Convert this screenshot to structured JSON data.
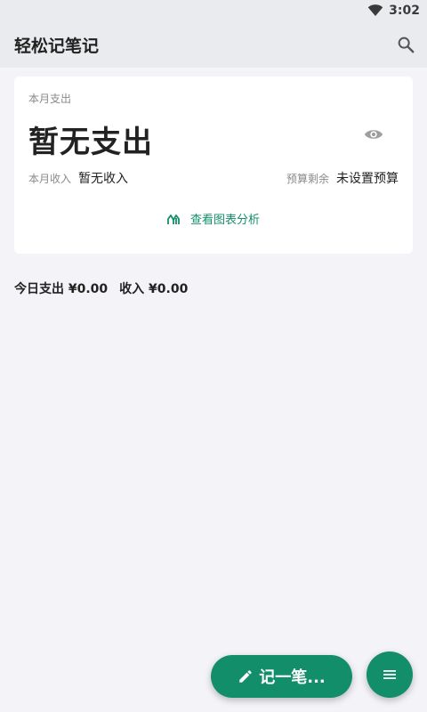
{
  "status_bar": {
    "time": "3:02",
    "icons": [
      "wifi-icon"
    ]
  },
  "app_bar": {
    "title": "轻松记笔记",
    "search_icon": "search-icon"
  },
  "summary_card": {
    "month_expense_label": "本月支出",
    "month_expense_value": "暂无支出",
    "visibility_icon": "eye-icon",
    "month_income_label": "本月收入",
    "month_income_value": "暂无收入",
    "budget_remaining_label": "预算剩余",
    "budget_remaining_value": "未设置预算",
    "chart_link_label": "查看图表分析",
    "chart_link_icon": "chart-icon"
  },
  "today": {
    "expense_text": "今日支出 ¥0.00",
    "income_text": "收入 ¥0.00"
  },
  "fab": {
    "record_label": "记一笔...",
    "record_icon": "pencil-icon",
    "menu_icon": "menu-icon"
  },
  "colors": {
    "accent": "#138e6a",
    "background": "#f4f4f8",
    "appbar": "#e9ebee",
    "card": "#ffffff"
  }
}
